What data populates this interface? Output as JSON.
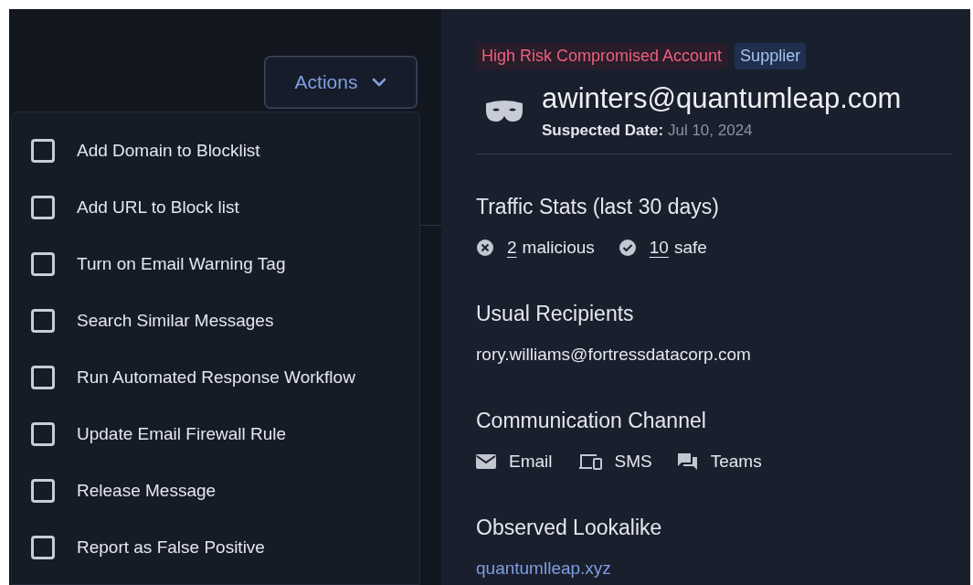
{
  "actions_button": {
    "label": "Actions",
    "expanded": true
  },
  "menu_items": [
    {
      "label": "Add Domain to Blocklist",
      "checked": false
    },
    {
      "label": "Add URL to Block list",
      "checked": false
    },
    {
      "label": "Turn on Email Warning Tag",
      "checked": false
    },
    {
      "label": "Search Similar Messages",
      "checked": false
    },
    {
      "label": "Run Automated Response Workflow",
      "checked": false
    },
    {
      "label": "Update Email Firewall Rule",
      "checked": false
    },
    {
      "label": "Release Message",
      "checked": false
    },
    {
      "label": "Report as False Positive",
      "checked": false
    }
  ],
  "detail": {
    "tags": [
      {
        "label": "High Risk Compromised Account",
        "kind": "risk"
      },
      {
        "label": "Supplier",
        "kind": "category"
      }
    ],
    "email": "awinters@quantumleap.com",
    "suspected_label": "Suspected Date:",
    "suspected_value": "Jul 10, 2024",
    "traffic": {
      "title": "Traffic Stats (last 30 days)",
      "stats": [
        {
          "kind": "malicious",
          "count": "2",
          "label": "malicious"
        },
        {
          "kind": "safe",
          "count": "10",
          "label": "safe"
        }
      ]
    },
    "recipients": {
      "title": "Usual Recipients",
      "items": [
        "rory.williams@fortressdatacorp.com"
      ]
    },
    "channels": {
      "title": "Communication Channel",
      "items": [
        {
          "kind": "email",
          "label": "Email"
        },
        {
          "kind": "sms",
          "label": "SMS"
        },
        {
          "kind": "teams",
          "label": "Teams"
        }
      ]
    },
    "lookalike": {
      "title": "Observed Lookalike",
      "link": "quantumlleap.xyz"
    }
  }
}
